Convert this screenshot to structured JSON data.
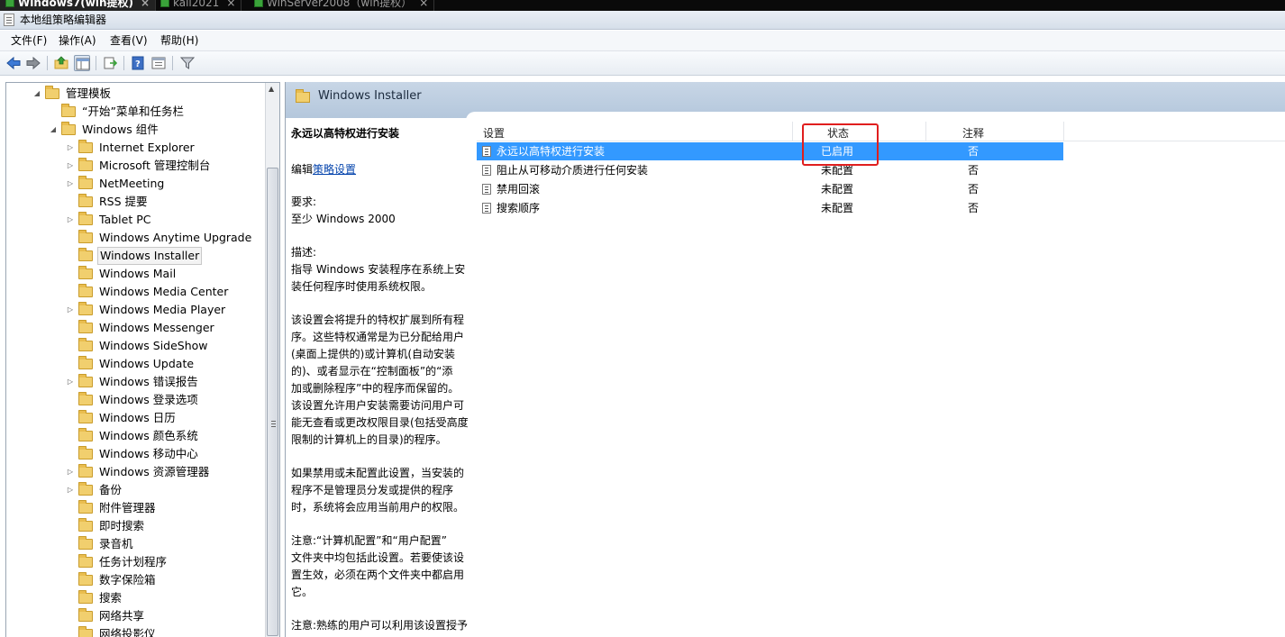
{
  "vm_tabs": [
    {
      "label": "Windows7(win提权)",
      "active": true
    },
    {
      "label": "kali2021",
      "active": false
    },
    {
      "label": "WinServer2008（win提权）",
      "active": false
    }
  ],
  "window": {
    "title": "本地组策略编辑器"
  },
  "menu": [
    "文件(F)",
    "操作(A)",
    "查看(V)",
    "帮助(H)"
  ],
  "toolbar_icons": [
    "back-icon",
    "forward-icon",
    "up-folder-icon",
    "show-tree-icon",
    "export-icon",
    "help-icon",
    "properties-icon",
    "filter-icon"
  ],
  "tree": {
    "root": "管理模板",
    "start_menu": "“开始”菜单和任务栏",
    "windows_components": "Windows 组件",
    "children": [
      {
        "label": "Internet Explorer",
        "expandable": true
      },
      {
        "label": "Microsoft 管理控制台",
        "expandable": true
      },
      {
        "label": "NetMeeting",
        "expandable": true
      },
      {
        "label": "RSS 提要",
        "expandable": false
      },
      {
        "label": "Tablet PC",
        "expandable": true
      },
      {
        "label": "Windows Anytime Upgrade",
        "expandable": false
      },
      {
        "label": "Windows Installer",
        "expandable": false,
        "selected": true
      },
      {
        "label": "Windows Mail",
        "expandable": false
      },
      {
        "label": "Windows Media Center",
        "expandable": false
      },
      {
        "label": "Windows Media Player",
        "expandable": true
      },
      {
        "label": "Windows Messenger",
        "expandable": false
      },
      {
        "label": "Windows SideShow",
        "expandable": false
      },
      {
        "label": "Windows Update",
        "expandable": false
      },
      {
        "label": "Windows 错误报告",
        "expandable": true
      },
      {
        "label": "Windows 登录选项",
        "expandable": false
      },
      {
        "label": "Windows 日历",
        "expandable": false
      },
      {
        "label": "Windows 颜色系统",
        "expandable": false
      },
      {
        "label": "Windows 移动中心",
        "expandable": false
      },
      {
        "label": "Windows 资源管理器",
        "expandable": true
      },
      {
        "label": "备份",
        "expandable": true
      },
      {
        "label": "附件管理器",
        "expandable": false
      },
      {
        "label": "即时搜索",
        "expandable": false
      },
      {
        "label": "录音机",
        "expandable": false
      },
      {
        "label": "任务计划程序",
        "expandable": false
      },
      {
        "label": "数字保险箱",
        "expandable": false
      },
      {
        "label": "搜索",
        "expandable": false
      },
      {
        "label": "网络共享",
        "expandable": false
      },
      {
        "label": "网络投影仪",
        "expandable": false
      }
    ]
  },
  "details": {
    "header": "Windows Installer",
    "setting_title": "永远以高特权进行安装",
    "edit_prefix": "编辑",
    "edit_link": "策略设置",
    "req_label": "要求:",
    "req_value": "至少 Windows 2000",
    "desc_label": "描述:",
    "desc_lines": [
      "指导 Windows 安装程序在系统上安",
      "装任何程序时使用系统权限。"
    ],
    "para2": [
      "该设置会将提升的特权扩展到所有程",
      "序。这些特权通常是为已分配给用户",
      "(桌面上提供的)或计算机(自动安装",
      "的)、或者显示在“控制面板”的“添",
      "加或删除程序”中的程序而保留的。",
      "该设置允许用户安装需要访问用户可",
      "能无查看或更改权限目录(包括受高度",
      "限制的计算机上的目录)的程序。"
    ],
    "para3": [
      "如果禁用或未配置此设置，当安装的",
      "程序不是管理员分发或提供的程序",
      "时，系统将会应用当前用户的权限。"
    ],
    "para4": [
      "注意:“计算机配置”和“用户配置”",
      "文件夹中均包括此设置。若要使该设",
      "置生效，必须在两个文件夹中都启用",
      "它。"
    ],
    "para5": [
      "注意:熟练的用户可以利用该设置授予"
    ]
  },
  "list": {
    "columns": {
      "setting": "设置",
      "state": "状态",
      "comment": "注释"
    },
    "rows": [
      {
        "name": "永远以高特权进行安装",
        "state": "已启用",
        "comment": "否",
        "selected": true
      },
      {
        "name": "阻止从可移动介质进行任何安装",
        "state": "未配置",
        "comment": "否",
        "selected": false
      },
      {
        "name": "禁用回滚",
        "state": "未配置",
        "comment": "否",
        "selected": false
      },
      {
        "name": "搜索顺序",
        "state": "未配置",
        "comment": "否",
        "selected": false
      }
    ]
  },
  "colors": {
    "selection": "#3399ff",
    "highlight_box": "#e01e1e",
    "header": "#c8d6e6",
    "link": "#0645ad"
  }
}
